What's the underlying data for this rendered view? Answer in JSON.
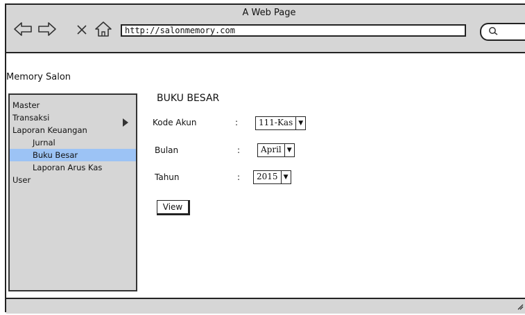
{
  "window": {
    "title": "A Web Page",
    "url": "http://salonmemory.com"
  },
  "icons": {
    "back": "back-arrow-icon",
    "forward": "forward-arrow-icon",
    "stop": "close-icon",
    "home": "home-icon",
    "search": "search-icon",
    "submenu": "triangle-right-icon"
  },
  "app": {
    "title": "Memory Salon"
  },
  "sidebar": {
    "items": [
      {
        "label": "Master"
      },
      {
        "label": "Transaksi"
      },
      {
        "label": "Laporan Keuangan"
      },
      {
        "label": "Jurnal"
      },
      {
        "label": "Buku Besar"
      },
      {
        "label": "Laporan Arus Kas"
      },
      {
        "label": "User"
      }
    ],
    "active_index": 4
  },
  "form": {
    "title": "BUKU BESAR",
    "separator": ":",
    "kode_akun": {
      "label": "Kode Akun",
      "value": "111-Kas"
    },
    "bulan": {
      "label": "Bulan",
      "value": "April"
    },
    "tahun": {
      "label": "Tahun",
      "value": "2015"
    },
    "view_label": "View"
  },
  "colors": {
    "chrome": "#d6d6d6",
    "active_item": "#9cc3f5"
  }
}
